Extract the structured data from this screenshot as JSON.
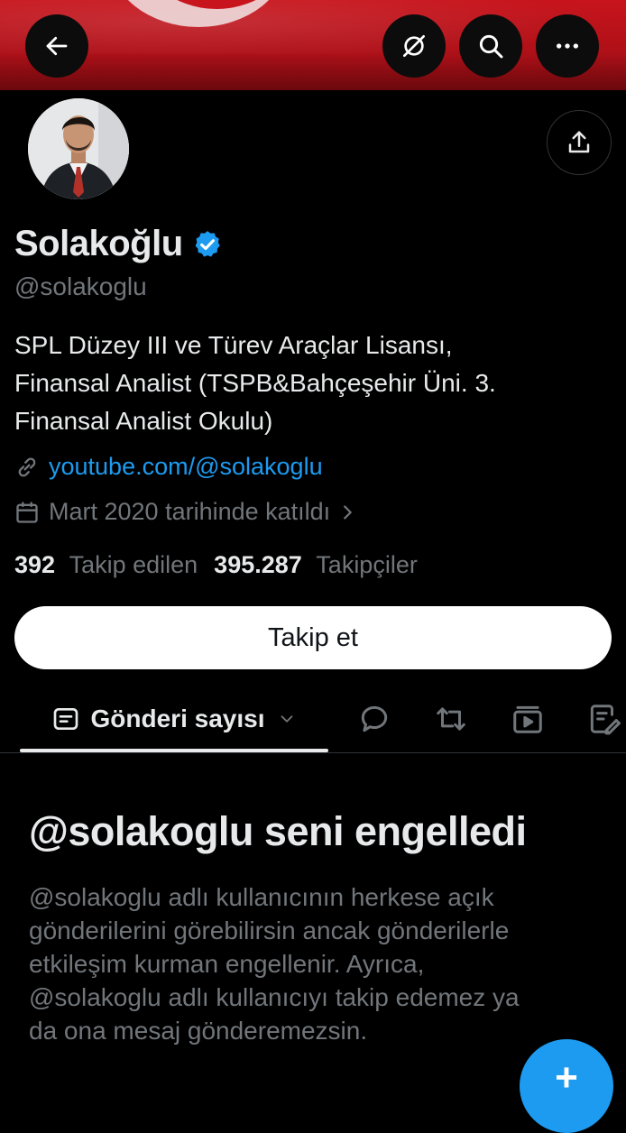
{
  "header": {
    "back_icon": "arrow-left-icon",
    "grok_icon": "grok-icon",
    "search_icon": "search-icon",
    "more_icon": "more-horizontal-icon"
  },
  "profile": {
    "display_name": "Solakoğlu",
    "handle": "@solakoglu",
    "bio_lines": [
      "SPL Düzey III ve Türev Araçlar Lisansı,",
      "Finansal Analist (TSPB&Bahçeşehir Üni. 3.",
      "Finansal Analist Okulu)"
    ],
    "link": "youtube.com/@solakoglu",
    "joined": "Mart 2020 tarihinde katıldı",
    "following_count": "392",
    "following_label": "Takip edilen",
    "followers_count": "395.287",
    "followers_label": "Takipçiler",
    "follow_button": "Takip et"
  },
  "tabs": {
    "active_label": "Gönderi sayısı",
    "icons": [
      "replies-icon",
      "repost-icon",
      "media-icon",
      "highlights-icon"
    ]
  },
  "blocked": {
    "title": "@solakoglu seni engelledi",
    "body_lines": [
      "@solakoglu adlı kullanıcının herkese açık",
      "gönderilerini görebilirsin ancak gönderilerle",
      "etkileşim kurman engellenir. Ayrıca,",
      "@solakoglu adlı kullanıcıyı takip edemez ya",
      "da ona mesaj gönderemezsin."
    ]
  },
  "fab": {
    "label": "+"
  },
  "colors": {
    "background": "#000000",
    "text": "#e7e9ea",
    "muted": "#71767b",
    "link": "#1d9bf0",
    "verified": "#1d9bf0",
    "banner_red": "#c8141c"
  }
}
